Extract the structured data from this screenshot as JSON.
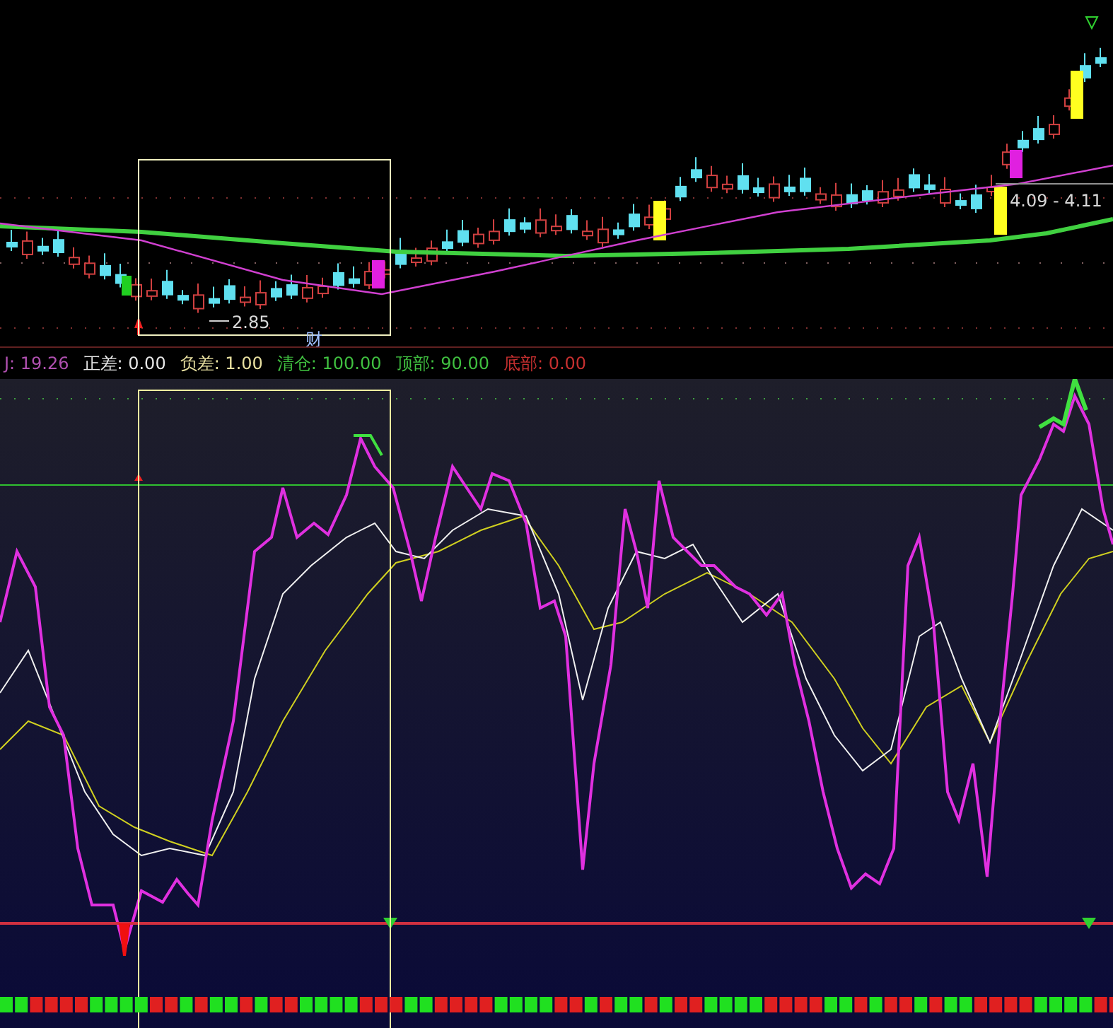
{
  "price_chart": {
    "low_label": "2.85",
    "marker_label": "财",
    "range_label": "4.09 - 4.11"
  },
  "indicator_legend": [
    {
      "label": "J: 19.26",
      "color": "#b050b0"
    },
    {
      "label": "正差: 0.00",
      "color": "#e8e8e8"
    },
    {
      "label": "负差: 1.00",
      "color": "#e8e0a0"
    },
    {
      "label": "清仓: 100.00",
      "color": "#40c040"
    },
    {
      "label": "顶部: 90.00",
      "color": "#40c040"
    },
    {
      "label": "底部: 0.00",
      "color": "#c83030"
    }
  ]
}
